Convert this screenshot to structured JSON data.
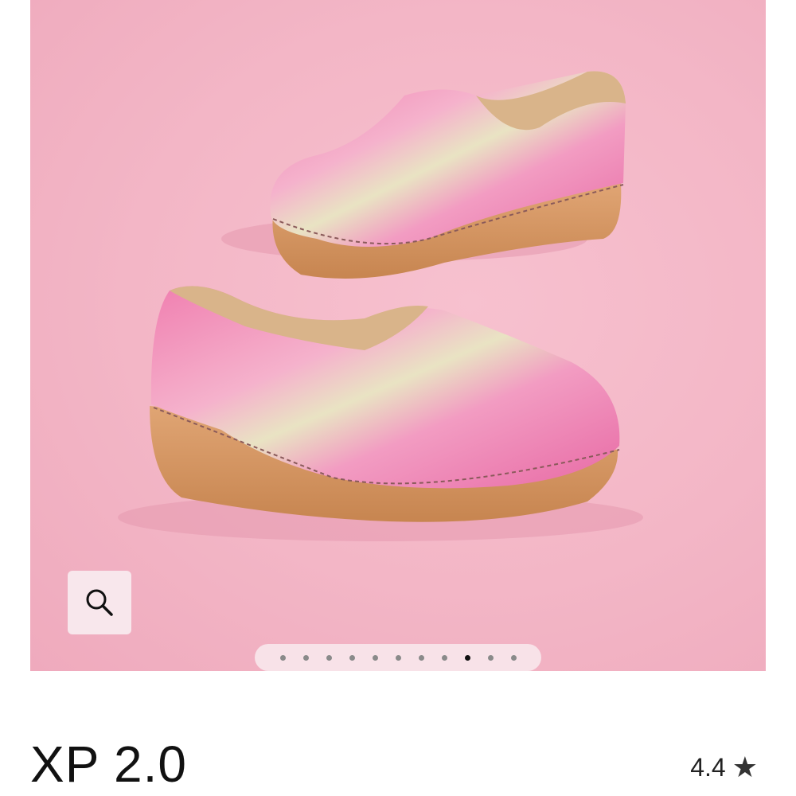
{
  "product": {
    "title": "XP 2.0",
    "rating": "4.4",
    "rating_star": "★"
  },
  "gallery": {
    "total_slides": 11,
    "active_index": 8,
    "zoom_icon": "search-icon",
    "background_color": "#f3b6c6"
  }
}
